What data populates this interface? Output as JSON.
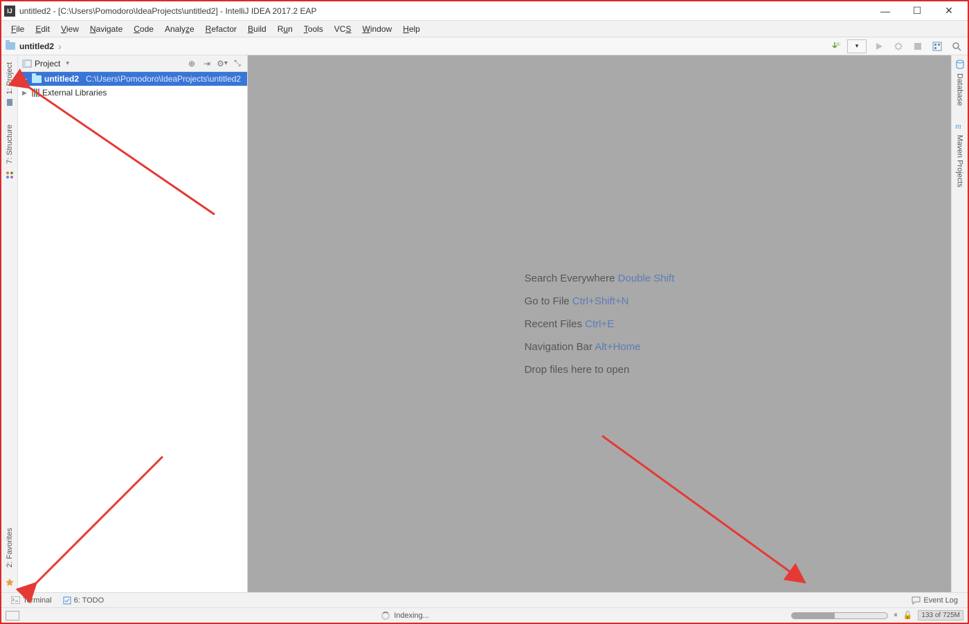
{
  "window": {
    "title": "untitled2 - [C:\\Users\\Pomodoro\\IdeaProjects\\untitled2] - IntelliJ IDEA 2017.2 EAP"
  },
  "menu": {
    "items": [
      "File",
      "Edit",
      "View",
      "Navigate",
      "Code",
      "Analyze",
      "Refactor",
      "Build",
      "Run",
      "Tools",
      "VCS",
      "Window",
      "Help"
    ]
  },
  "breadcrumb": {
    "root": "untitled2"
  },
  "project_panel": {
    "title": "Project",
    "root": {
      "name": "untitled2",
      "path": "C:\\Users\\Pomodoro\\IdeaProjects\\untitled2"
    },
    "external_libs": "External Libraries"
  },
  "left_tools": {
    "project": "1: Project",
    "structure": "7: Structure",
    "favorites": "2: Favorites"
  },
  "right_tools": {
    "database": "Database",
    "maven": "Maven Projects"
  },
  "editor_hints": [
    {
      "label": "Search Everywhere",
      "key": "Double Shift"
    },
    {
      "label": "Go to File",
      "key": "Ctrl+Shift+N"
    },
    {
      "label": "Recent Files",
      "key": "Ctrl+E"
    },
    {
      "label": "Navigation Bar",
      "key": "Alt+Home"
    },
    {
      "label": "Drop files here to open",
      "key": ""
    }
  ],
  "bottom_tools": {
    "terminal": "Terminal",
    "todo": "6: TODO",
    "event_log": "Event Log"
  },
  "status": {
    "task": "Indexing...",
    "memory": "133 of 725M"
  }
}
